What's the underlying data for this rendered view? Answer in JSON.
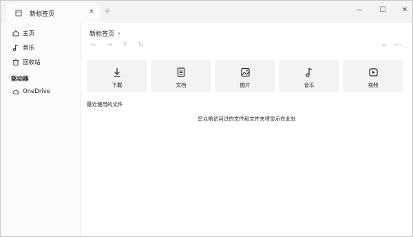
{
  "tab": {
    "title": "新标签页",
    "close": "✕",
    "new": "+"
  },
  "window_controls": {
    "minimize": "—",
    "maximize": "☐",
    "close": "✕"
  },
  "sidebar": {
    "items": [
      {
        "label": "主页",
        "icon": "home-icon"
      },
      {
        "label": "音乐",
        "icon": "music-icon"
      },
      {
        "label": "回收站",
        "icon": "recycle-bin-icon"
      }
    ],
    "drives_header": "驱动器",
    "onedrive": {
      "label": "OneDrive",
      "icon": "cloud-icon"
    }
  },
  "breadcrumb": {
    "current": "新标签页",
    "chevron": "›"
  },
  "toolbar": {
    "back": "←",
    "forward": "→",
    "up": "↑",
    "refresh": "↻",
    "search": "⌕",
    "more": "⋯"
  },
  "quick_access": [
    {
      "label": "下载",
      "icon": "download-icon"
    },
    {
      "label": "文档",
      "icon": "document-icon"
    },
    {
      "label": "图片",
      "icon": "image-icon"
    },
    {
      "label": "音乐",
      "icon": "music-icon"
    },
    {
      "label": "视频",
      "icon": "video-icon"
    }
  ],
  "recent": {
    "title": "最近使用的文件",
    "empty_message": "您以前访问过的文件和文件夹将显示在此处"
  }
}
